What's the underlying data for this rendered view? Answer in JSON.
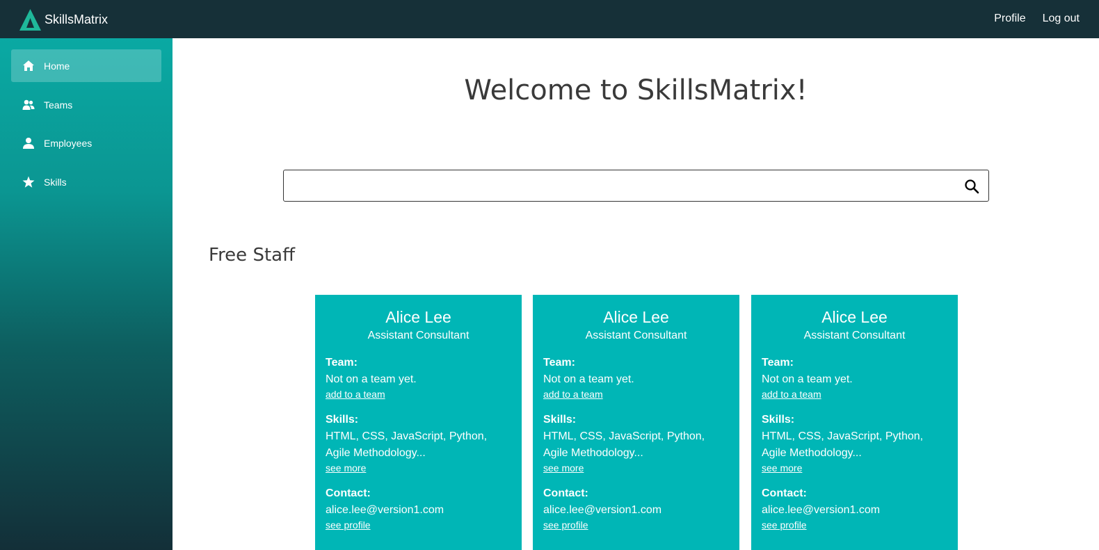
{
  "header": {
    "brand": "SkillsMatrix",
    "nav": [
      "Profile",
      "Log out"
    ]
  },
  "sidebar": {
    "items": [
      {
        "label": "Home",
        "icon": "home-icon",
        "active": true
      },
      {
        "label": "Teams",
        "icon": "team-icon",
        "active": false
      },
      {
        "label": "Employees",
        "icon": "person-icon",
        "active": false
      },
      {
        "label": "Skills",
        "icon": "star-icon",
        "active": false
      }
    ]
  },
  "main": {
    "title": "Welcome to SkillsMatrix!",
    "search": {
      "placeholder": "",
      "value": ""
    },
    "section_title": "Free Staff",
    "cards": [
      {
        "name": "Alice Lee",
        "role": "Assistant Consultant",
        "team_label": "Team:",
        "team": "Not on a team yet.",
        "team_link": "add to a team",
        "skills_label": "Skills:",
        "skills": "HTML, CSS, JavaScript, Python, Agile Methodology...",
        "skills_link": "see more",
        "contact_label": "Contact:",
        "contact": "alice.lee@version1.com",
        "contact_link": "see profile"
      },
      {
        "name": "Alice Lee",
        "role": "Assistant Consultant",
        "team_label": "Team:",
        "team": "Not on a team yet.",
        "team_link": "add to a team",
        "skills_label": "Skills:",
        "skills": "HTML, CSS, JavaScript, Python, Agile Methodology...",
        "skills_link": "see more",
        "contact_label": "Contact:",
        "contact": "alice.lee@version1.com",
        "contact_link": "see profile"
      },
      {
        "name": "Alice Lee",
        "role": "Assistant Consultant",
        "team_label": "Team:",
        "team": "Not on a team yet.",
        "team_link": "add to a team",
        "skills_label": "Skills:",
        "skills": "HTML, CSS, JavaScript, Python, Agile Methodology...",
        "skills_link": "see more",
        "contact_label": "Contact:",
        "contact": "alice.lee@version1.com",
        "contact_link": "see profile"
      }
    ]
  },
  "colors": {
    "topbar": "#163038",
    "accent": "#00b6b6",
    "logo": "#1fb89a"
  }
}
